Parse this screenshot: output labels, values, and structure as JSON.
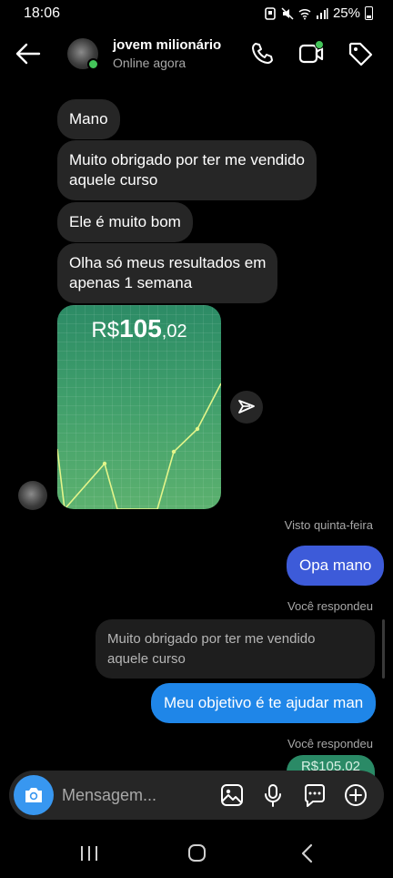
{
  "status": {
    "time": "18:06",
    "battery": "25%"
  },
  "header": {
    "name": "jovem milionário",
    "status": "Online agora"
  },
  "messages": {
    "m1": "Mano",
    "m2a": "Muito obrigado por ter me vendido",
    "m2b": "aquele curso",
    "m3": "Ele é muito bom",
    "m4a": "Olha só meus resultados em",
    "m4b": "apenas 1 semana",
    "photo": {
      "currency": "R$",
      "integer": "105",
      "decimals": ",02"
    },
    "seen": "Visto quinta-feira",
    "reply1": "Opa mano",
    "replied1": "Você respondeu",
    "quote_a": "Muito obrigado por ter me vendido",
    "quote_b": "aquele curso",
    "reply2": "Meu objetivo é te ajudar man",
    "replied2": "Você respondeu",
    "peek": "R$105,02"
  },
  "composer": {
    "placeholder": "Mensagem..."
  },
  "colors": {
    "accent": "#3797f0",
    "bubble_in": "#262626",
    "online": "#44c55a",
    "card": "#3f9e6b"
  },
  "icons": [
    "back-arrow-icon",
    "call-icon",
    "video-icon",
    "tag-icon",
    "share-icon",
    "camera-icon",
    "gallery-icon",
    "mic-icon",
    "sticker-icon",
    "plus-icon",
    "recent-apps-icon",
    "home-icon",
    "back-nav-icon"
  ]
}
